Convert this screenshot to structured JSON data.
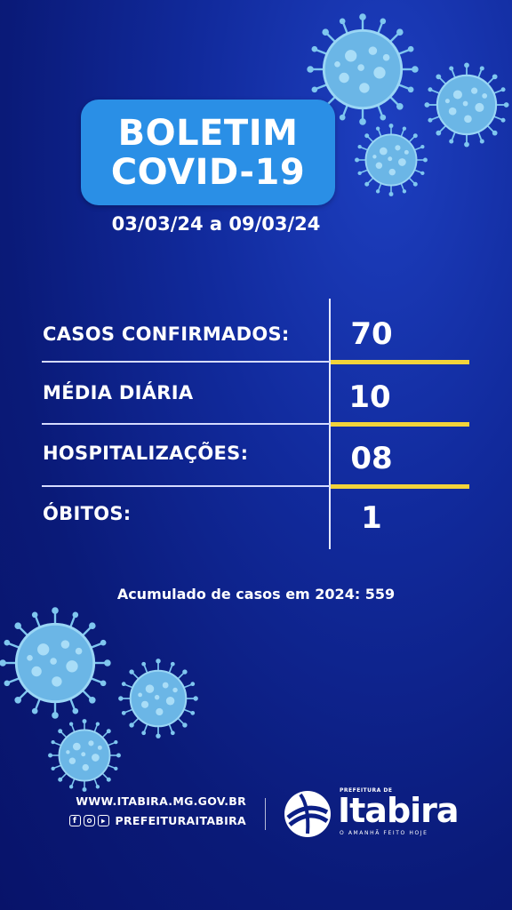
{
  "title": {
    "line1": "BOLETIM",
    "line2": "COVID-19"
  },
  "date_range": "03/03/24 a 09/03/24",
  "stats": [
    {
      "label": "CASOS CONFIRMADOS:",
      "value": "70"
    },
    {
      "label": "MÉDIA DIÁRIA",
      "value": "10"
    },
    {
      "label": "HOSPITALIZAÇÕES:",
      "value": "08"
    },
    {
      "label": "ÓBITOS:",
      "value": "1"
    }
  ],
  "accumulated": "Acumulado de casos em 2024: 559",
  "footer": {
    "website": "WWW.ITABIRA.MG.GOV.BR",
    "social_handle": "PREFEITURAITABIRA",
    "social_icons": [
      "facebook-icon",
      "instagram-icon",
      "youtube-icon"
    ]
  },
  "logo": {
    "small_text": "PREFEITURA DE",
    "name": "Itabira",
    "tagline": "O AMANHÃ FEITO HOJE"
  },
  "colors": {
    "background": "#0a1a78",
    "title_box": "#2a8fe6",
    "accent_line": "#f2d33a",
    "virus": "#7fc6ef"
  }
}
